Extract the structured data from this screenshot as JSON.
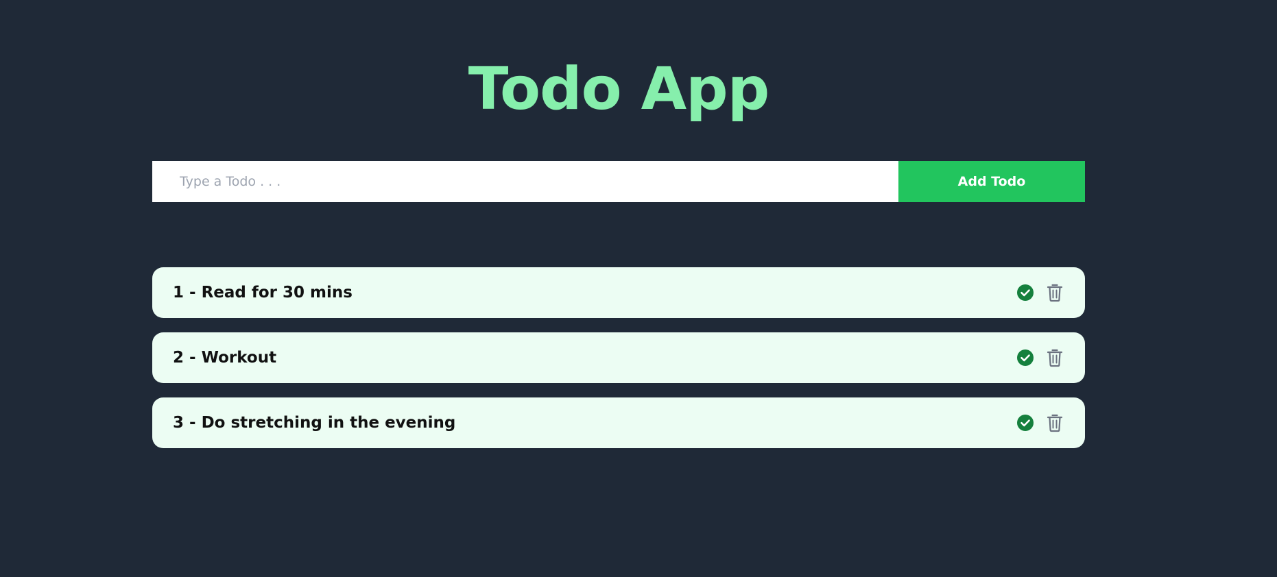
{
  "app": {
    "title": "Todo App"
  },
  "input": {
    "placeholder": "Type a Todo . . .",
    "value": ""
  },
  "add_button": {
    "label": "Add Todo"
  },
  "todos": [
    {
      "text": "1 - Read for 30 mins",
      "complete_icon": "check-circle-icon",
      "delete_icon": "trash-icon"
    },
    {
      "text": "2 - Workout",
      "complete_icon": "check-circle-icon",
      "delete_icon": "trash-icon"
    },
    {
      "text": "3 - Do stretching in the evening",
      "complete_icon": "check-circle-icon",
      "delete_icon": "trash-icon"
    }
  ],
  "colors": {
    "background": "#1f2937",
    "title": "#86efac",
    "accent": "#22c55e",
    "item_background": "#ecfdf3",
    "check": "#15803d",
    "trash": "#6b7280"
  }
}
